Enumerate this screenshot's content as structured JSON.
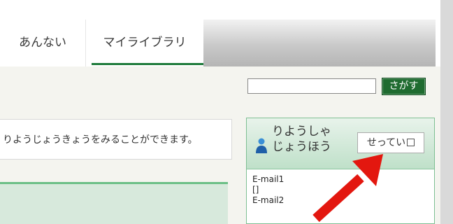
{
  "tabs": {
    "annai": "あんない",
    "mylibrary": "マイライブラリ"
  },
  "search": {
    "value": "",
    "button_label": "さがす"
  },
  "info_text": "りようじょうきょうをみることができます。",
  "user_panel": {
    "title_line1": "りようしゃ",
    "title_line2": "じょうほう",
    "settings_label": "せってい",
    "email1_label": "E-mail1",
    "email1_value": "[]",
    "email2_label": "E-mail2"
  },
  "colors": {
    "accent_green": "#1f6b30",
    "panel_green": "#7dbf92",
    "arrow_red": "#e3170f"
  }
}
